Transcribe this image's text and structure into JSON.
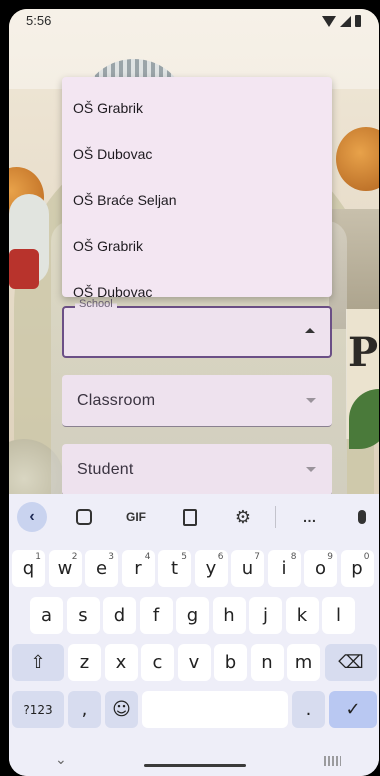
{
  "status_bar": {
    "time": "5:56"
  },
  "form": {
    "school": {
      "label": "School"
    },
    "classroom": {
      "label": "Classroom"
    },
    "student": {
      "label": "Student"
    }
  },
  "dropdown": {
    "options": [
      "OŠ Grabrik",
      "OŠ Dubovac",
      "OŠ Braće Seljan",
      "OŠ Grabrik",
      "OŠ Dubovac"
    ]
  },
  "keyboard": {
    "toolbar": {
      "gif_label": "GIF",
      "more_label": "…"
    },
    "row1": [
      {
        "k": "q",
        "h": "1"
      },
      {
        "k": "w",
        "h": "2"
      },
      {
        "k": "e",
        "h": "3"
      },
      {
        "k": "r",
        "h": "4"
      },
      {
        "k": "t",
        "h": "5"
      },
      {
        "k": "y",
        "h": "6"
      },
      {
        "k": "u",
        "h": "7"
      },
      {
        "k": "i",
        "h": "8"
      },
      {
        "k": "o",
        "h": "9"
      },
      {
        "k": "p",
        "h": "0"
      }
    ],
    "row2": [
      "a",
      "s",
      "d",
      "f",
      "g",
      "h",
      "j",
      "k",
      "l"
    ],
    "row3": [
      "z",
      "x",
      "c",
      "v",
      "b",
      "n",
      "m"
    ],
    "symbols_label": "?123",
    "comma_label": ",",
    "period_label": ".",
    "emoji_glyph": "☺",
    "shift_glyph": "⇧",
    "backspace_glyph": "⌫",
    "enter_glyph": "✓"
  },
  "colors": {
    "field_bg": "#eee2ee",
    "field_focus_border": "#6b4f86",
    "menu_bg": "#f3e6f2",
    "keyboard_bg": "#eeeef8",
    "accent_key": "#b9c8f2"
  }
}
